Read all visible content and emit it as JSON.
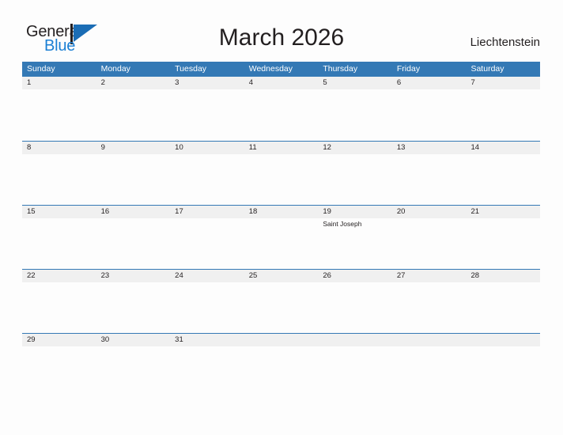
{
  "brand": {
    "name_part1": "General",
    "name_part2": "Blue",
    "mark_icon": "flag-triangle-icon",
    "accent_color": "#1b6db5",
    "blue_text_color": "#1b7fd4"
  },
  "header": {
    "title": "March 2026",
    "locale": "Liechtenstein"
  },
  "theme": {
    "header_bar_color": "#3479b5",
    "date_band_color": "#f0f0f0",
    "divider_color": "#3479b5",
    "page_background": "#fdfdfd",
    "text_color": "#231f20"
  },
  "calendar": {
    "month": "March",
    "year": "2026",
    "weekdays": [
      "Sunday",
      "Monday",
      "Tuesday",
      "Wednesday",
      "Thursday",
      "Friday",
      "Saturday"
    ],
    "weeks": [
      {
        "days": [
          {
            "num": "1",
            "events": []
          },
          {
            "num": "2",
            "events": []
          },
          {
            "num": "3",
            "events": []
          },
          {
            "num": "4",
            "events": []
          },
          {
            "num": "5",
            "events": []
          },
          {
            "num": "6",
            "events": []
          },
          {
            "num": "7",
            "events": []
          }
        ]
      },
      {
        "days": [
          {
            "num": "8",
            "events": []
          },
          {
            "num": "9",
            "events": []
          },
          {
            "num": "10",
            "events": []
          },
          {
            "num": "11",
            "events": []
          },
          {
            "num": "12",
            "events": []
          },
          {
            "num": "13",
            "events": []
          },
          {
            "num": "14",
            "events": []
          }
        ]
      },
      {
        "days": [
          {
            "num": "15",
            "events": []
          },
          {
            "num": "16",
            "events": []
          },
          {
            "num": "17",
            "events": []
          },
          {
            "num": "18",
            "events": []
          },
          {
            "num": "19",
            "events": [
              "Saint Joseph"
            ]
          },
          {
            "num": "20",
            "events": []
          },
          {
            "num": "21",
            "events": []
          }
        ]
      },
      {
        "days": [
          {
            "num": "22",
            "events": []
          },
          {
            "num": "23",
            "events": []
          },
          {
            "num": "24",
            "events": []
          },
          {
            "num": "25",
            "events": []
          },
          {
            "num": "26",
            "events": []
          },
          {
            "num": "27",
            "events": []
          },
          {
            "num": "28",
            "events": []
          }
        ]
      },
      {
        "days": [
          {
            "num": "29",
            "events": []
          },
          {
            "num": "30",
            "events": []
          },
          {
            "num": "31",
            "events": []
          },
          {
            "num": "",
            "events": []
          },
          {
            "num": "",
            "events": []
          },
          {
            "num": "",
            "events": []
          },
          {
            "num": "",
            "events": []
          }
        ]
      }
    ]
  }
}
